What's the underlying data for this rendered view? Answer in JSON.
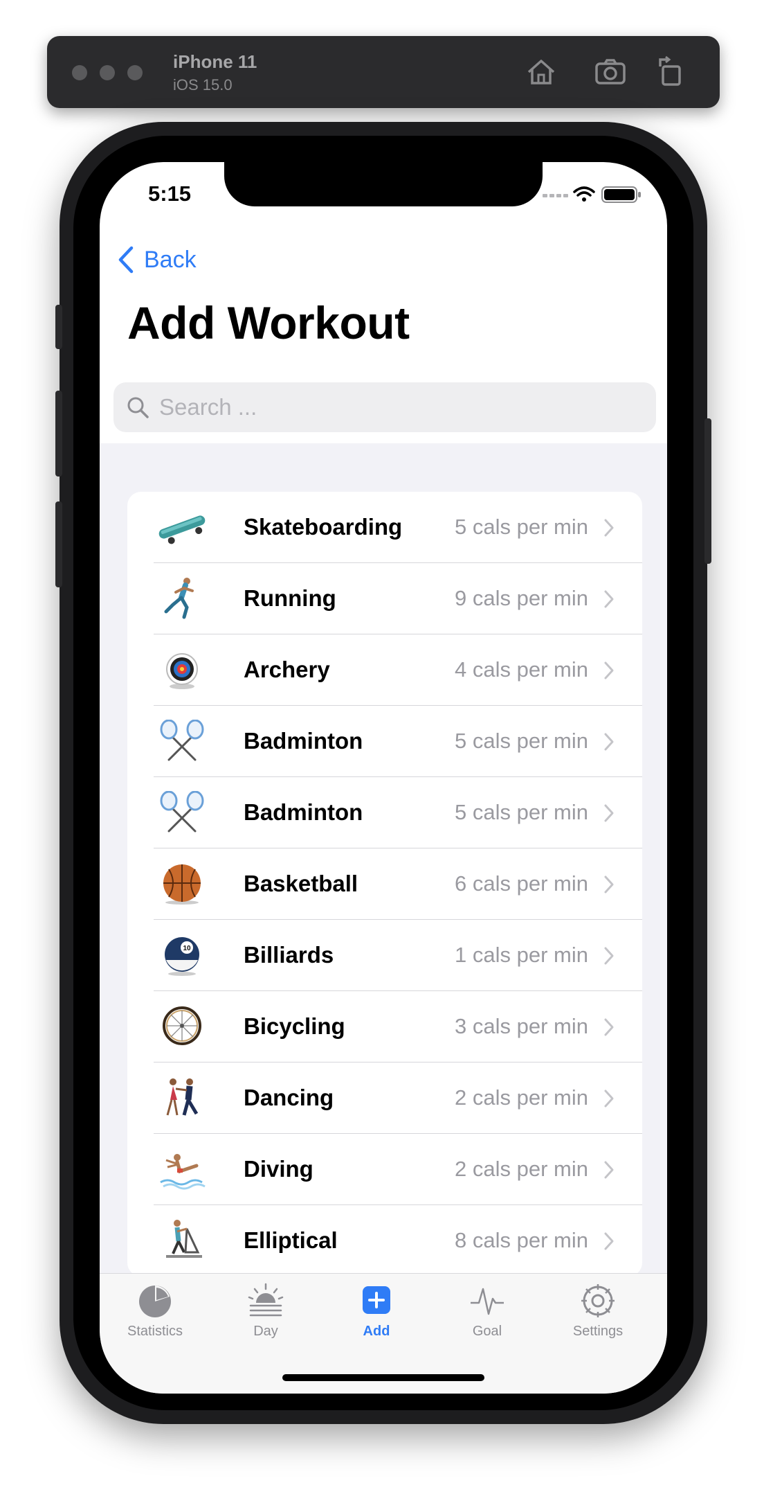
{
  "simulator": {
    "device": "iPhone 11",
    "os": "iOS 15.0",
    "buttons": [
      "home-icon",
      "screenshot-icon",
      "rotate-icon"
    ]
  },
  "status_bar": {
    "time": "5:15"
  },
  "nav": {
    "back_label": "Back",
    "title": "Add Workout"
  },
  "search": {
    "placeholder": "Search ...",
    "value": ""
  },
  "workouts": [
    {
      "icon": "skateboard-icon",
      "name": "Skateboarding",
      "cals": "5 cals per min"
    },
    {
      "icon": "runner-icon",
      "name": "Running",
      "cals": "9 cals per min"
    },
    {
      "icon": "archery-target-icon",
      "name": "Archery",
      "cals": "4 cals per min"
    },
    {
      "icon": "badminton-icon",
      "name": "Badminton",
      "cals": "5 cals per min"
    },
    {
      "icon": "badminton-icon",
      "name": "Badminton",
      "cals": "5 cals per min"
    },
    {
      "icon": "basketball-icon",
      "name": "Basketball",
      "cals": "6 cals per min"
    },
    {
      "icon": "billiard-ball-icon",
      "name": "Billiards",
      "cals": "1 cals per min"
    },
    {
      "icon": "bicycle-wheel-icon",
      "name": "Bicycling",
      "cals": "3 cals per min"
    },
    {
      "icon": "dancers-icon",
      "name": "Dancing",
      "cals": "2 cals per min"
    },
    {
      "icon": "diver-icon",
      "name": "Diving",
      "cals": "2 cals per min"
    },
    {
      "icon": "elliptical-icon",
      "name": "Elliptical",
      "cals": "8 cals per min"
    }
  ],
  "tabs": [
    {
      "icon": "pie-chart-icon",
      "label": "Statistics",
      "active": false
    },
    {
      "icon": "sunrise-icon",
      "label": "Day",
      "active": false
    },
    {
      "icon": "plus-square-icon",
      "label": "Add",
      "active": true
    },
    {
      "icon": "waveform-icon",
      "label": "Goal",
      "active": false
    },
    {
      "icon": "gear-icon",
      "label": "Settings",
      "active": false
    }
  ],
  "colors": {
    "accent": "#2f7cf6",
    "secondary_text": "#9a9aa0",
    "grouped_bg": "#f2f2f7"
  }
}
